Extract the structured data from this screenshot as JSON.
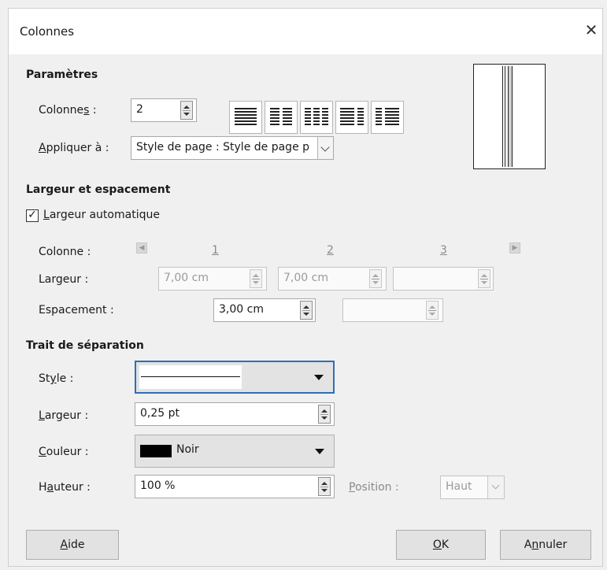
{
  "window": {
    "title": "Colonnes",
    "close_label": "✕"
  },
  "parametres": {
    "heading": "Paramètres",
    "colonnes_label_pre": "Colonne",
    "colonnes_label_u": "s",
    "colonnes_label_post": " :",
    "colonnes_value": "2",
    "appliquer_label_u": "A",
    "appliquer_label_post": "ppliquer à :",
    "appliquer_value": "Style de page : Style de page p"
  },
  "largeur_espacement": {
    "heading": "Largeur et espacement",
    "auto_checked_mark": "✓",
    "auto_label_u": "L",
    "auto_label_post": "argeur automatique",
    "colonne_label": "Colonne :",
    "col_numbers": [
      "1",
      "2",
      "3"
    ],
    "largeur_label": "Largeur :",
    "largeur_values": [
      "7,00 cm",
      "7,00 cm",
      ""
    ],
    "espacement_label": "Espacement :",
    "espacement_values": [
      "3,00 cm",
      ""
    ]
  },
  "trait": {
    "heading": "Trait de séparation",
    "style_label_pre": "St",
    "style_label_u": "y",
    "style_label_post": "le :",
    "largeur_label_u": "L",
    "largeur_label_post": "argeur :",
    "largeur_value": "0,25 pt",
    "couleur_label_u": "C",
    "couleur_label_post": "ouleur :",
    "couleur_value": "Noir",
    "couleur_swatch": "#000000",
    "hauteur_label_pre": "H",
    "hauteur_label_u": "a",
    "hauteur_label_post": "uteur :",
    "hauteur_value": "100 %",
    "position_label_u": "P",
    "position_label_post": "osition :",
    "position_value": "Haut"
  },
  "buttons": {
    "aide_u": "A",
    "aide_post": "ide",
    "ok_u": "O",
    "ok_post": "K",
    "annuler_pre": "A",
    "annuler_u": "n",
    "annuler_post": "nuler"
  },
  "colors": {
    "focus_border": "#2e6fb5",
    "dialog_bg": "#f0f0f0"
  }
}
